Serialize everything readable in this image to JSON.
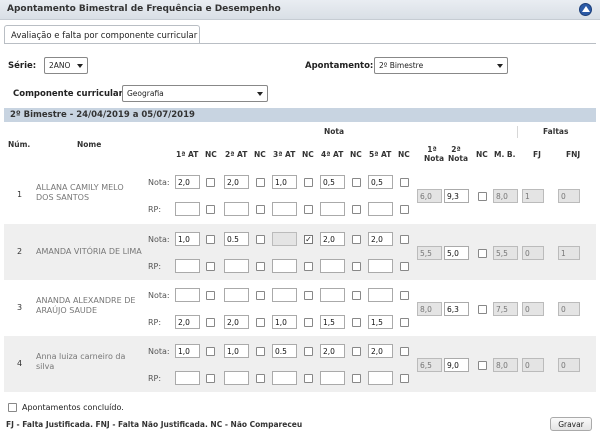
{
  "window": {
    "title": "Apontamento Bimestral de Frequência e Desempenho",
    "collapse_icon": "chevron-up-icon"
  },
  "tab": {
    "label": "Avaliação e falta por componente curricular"
  },
  "filters": {
    "serie_label": "Série:",
    "serie_value": "2ANO",
    "apontamento_label": "Apontamento:",
    "apontamento_value": "2º Bimestre",
    "componente_label": "Componente curricular:",
    "componente_value": "Geografia"
  },
  "period": {
    "title": "2º Bimestre - 24/04/2019 a 05/07/2019"
  },
  "table": {
    "headers": {
      "num": "Núm.",
      "nome": "Nome",
      "nota": "Nota",
      "faltas": "Faltas",
      "at1": "1ª AT",
      "nc1": "NC",
      "at2": "2ª AT",
      "nc2": "NC",
      "at3": "3ª AT",
      "nc3": "NC",
      "at4": "4ª AT",
      "nc4": "NC",
      "at5": "5ª AT",
      "nc5": "NC",
      "nota1_l1": "1ª",
      "nota1_l2": "Nota",
      "nota2_l1": "2ª",
      "nota2_l2": "Nota",
      "nc6": "NC",
      "mb": "M. B.",
      "fj": "FJ",
      "fnj": "FNJ"
    },
    "row_labels": {
      "nota": "Nota:",
      "rp": "RP:"
    },
    "students": [
      {
        "num": "1",
        "name": "ALLANA CAMILY MELO DOS SANTOS",
        "nota": [
          "2,0",
          "2,0",
          "1,0",
          "0,5",
          "0,5"
        ],
        "rp": [
          "",
          "",
          "",
          "",
          ""
        ],
        "n1": "6,0",
        "n2": "9,3",
        "mb": "8,0",
        "fj": "1",
        "fnj": "0"
      },
      {
        "num": "2",
        "name": "AMANDA VITÓRIA DE LIMA",
        "nota": [
          "1,0",
          "0.5",
          "",
          "2,0",
          "2,0"
        ],
        "rp": [
          "",
          "",
          "",
          "",
          ""
        ],
        "n1": "5,5",
        "n2": "5,0",
        "mb": "5,5",
        "fj": "0",
        "fnj": "1"
      },
      {
        "num": "3",
        "name": "ANANDA ALEXANDRE DE ARAÚJO SAUDE",
        "nota": [
          "",
          "",
          "",
          "",
          ""
        ],
        "rp": [
          "2,0",
          "2,0",
          "1,0",
          "1,5",
          "1,5"
        ],
        "n1": "8,0",
        "n2": "6,3",
        "mb": "7,5",
        "fj": "0",
        "fnj": "0"
      },
      {
        "num": "4",
        "name": "Anna luiza carneiro da silva",
        "nota": [
          "1,0",
          "1,0",
          "0.5",
          "2,0",
          "2,0"
        ],
        "rp": [
          "",
          "",
          "",
          "",
          ""
        ],
        "n1": "6,5",
        "n2": "9,0",
        "mb": "8,0",
        "fj": "0",
        "fnj": "0"
      }
    ]
  },
  "footer": {
    "concluido_label": "Apontamentos concluído.",
    "legend": "FJ - Falta Justificada. FNJ - Falta Não Justificada. NC - Não Compareceu",
    "save_label": "Gravar"
  }
}
